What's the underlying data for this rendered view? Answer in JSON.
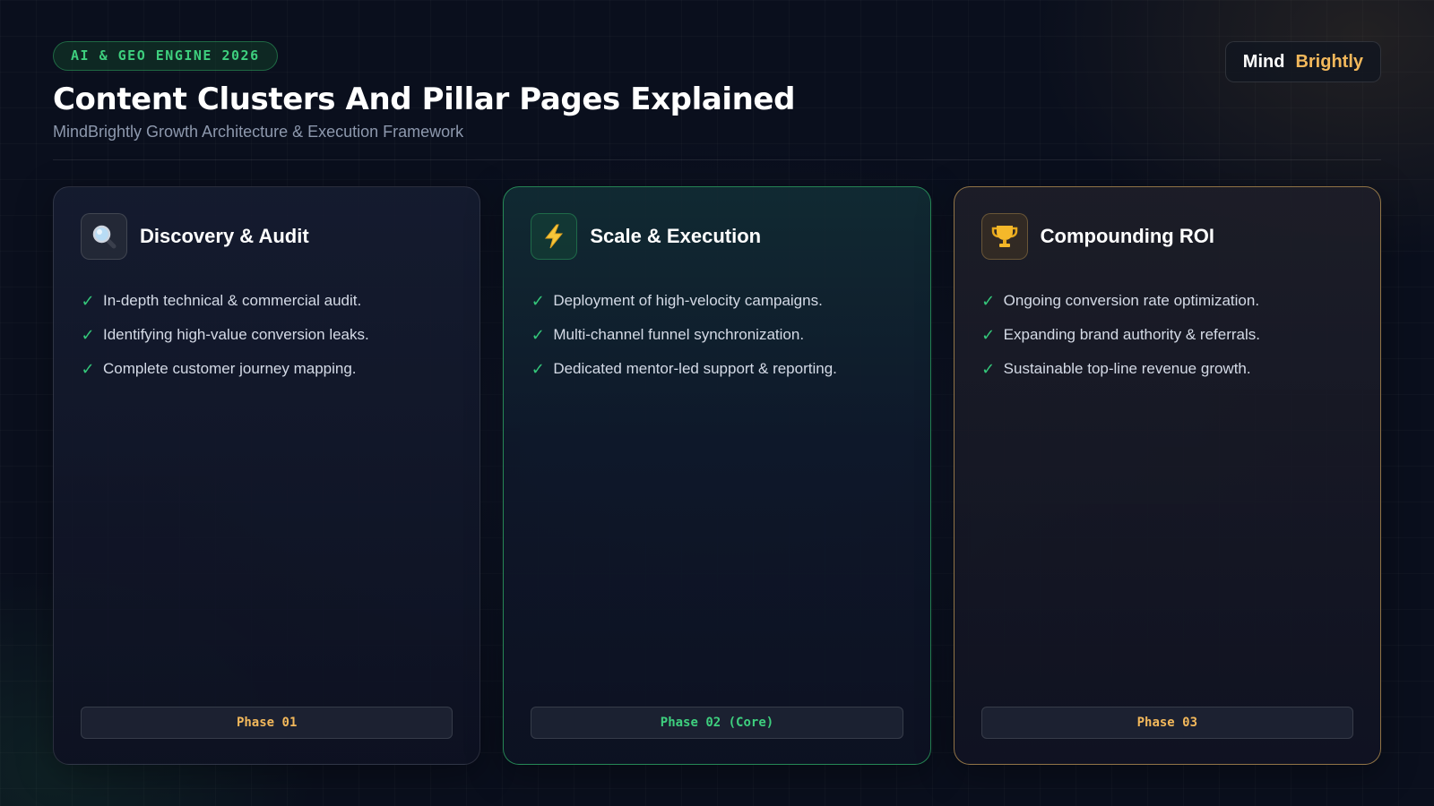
{
  "header": {
    "tag": "AI & GEO ENGINE 2026",
    "title": "Content Clusters And Pillar Pages Explained",
    "subtitle": "MindBrightly Growth Architecture & Execution Framework"
  },
  "brand": {
    "part1": "Mind",
    "part2": "Brightly"
  },
  "colors": {
    "accent_green": "#3ecf7e",
    "accent_gold": "#f2b85b",
    "background": "#0a0f1d"
  },
  "cards": [
    {
      "icon": "magnifier-icon",
      "title": "Discovery & Audit",
      "points": [
        "In-depth technical & commercial audit.",
        "Identifying high-value conversion leaks.",
        "Complete customer journey mapping."
      ],
      "phase": "Phase 01"
    },
    {
      "icon": "lightning-icon",
      "title": "Scale & Execution",
      "points": [
        "Deployment of high-velocity campaigns.",
        "Multi-channel funnel synchronization.",
        "Dedicated mentor-led support & reporting."
      ],
      "phase": "Phase 02 (Core)"
    },
    {
      "icon": "trophy-icon",
      "title": "Compounding ROI",
      "points": [
        "Ongoing conversion rate optimization.",
        "Expanding brand authority & referrals.",
        "Sustainable top-line revenue growth."
      ],
      "phase": "Phase 03"
    }
  ]
}
